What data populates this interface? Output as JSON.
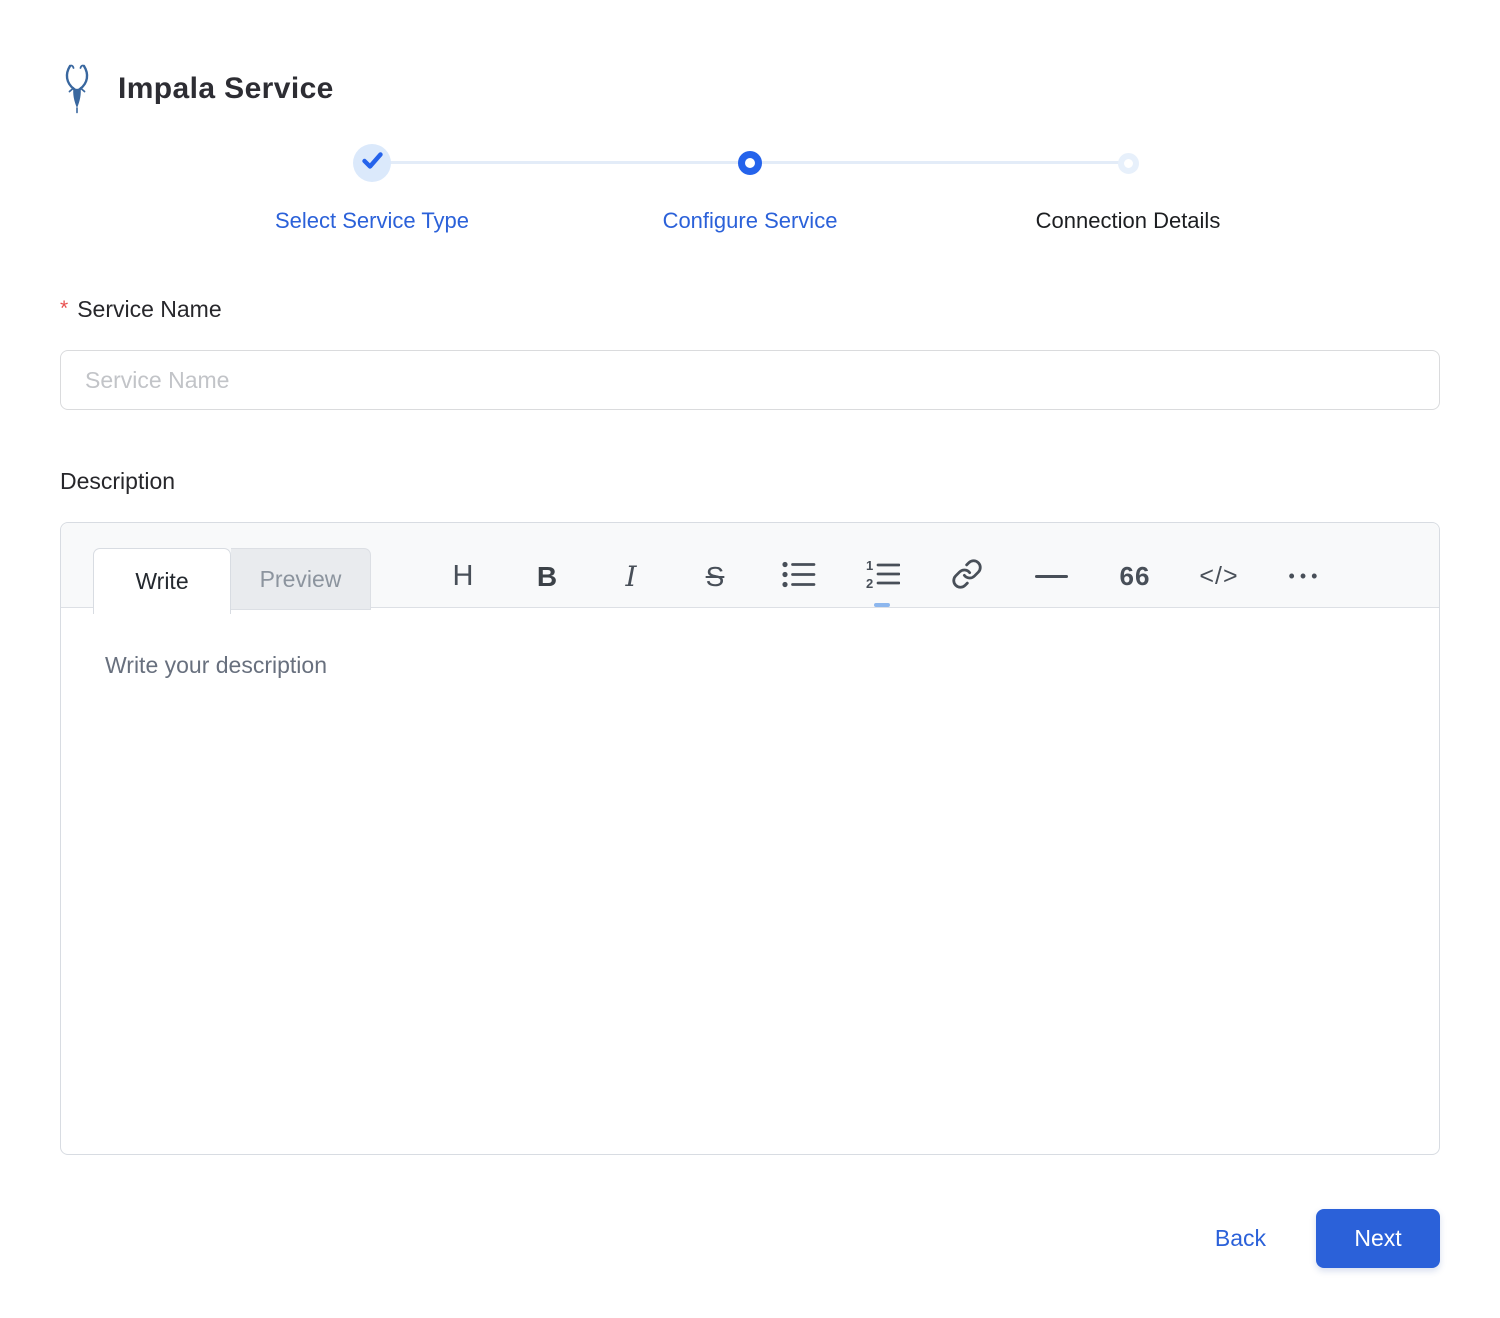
{
  "header": {
    "title": "Impala Service",
    "logo": "impala-antelope-logo"
  },
  "stepper": {
    "steps": [
      {
        "label": "Select Service Type",
        "state": "completed"
      },
      {
        "label": "Configure Service",
        "state": "active"
      },
      {
        "label": "Connection Details",
        "state": "pending"
      }
    ]
  },
  "form": {
    "service_name": {
      "label": "Service Name",
      "required_marker": "*",
      "value": "",
      "placeholder": "Service Name"
    },
    "description": {
      "label": "Description",
      "value": "",
      "placeholder": "Write your description"
    }
  },
  "editor": {
    "tabs": [
      {
        "label": "Write",
        "active": true
      },
      {
        "label": "Preview",
        "active": false
      }
    ],
    "toolbar": [
      {
        "name": "heading",
        "glyph": "H"
      },
      {
        "name": "bold",
        "glyph": "B"
      },
      {
        "name": "italic",
        "glyph": "I"
      },
      {
        "name": "strikethrough",
        "glyph": "S"
      },
      {
        "name": "unordered-list",
        "glyph": ""
      },
      {
        "name": "ordered-list",
        "glyph": ""
      },
      {
        "name": "link",
        "glyph": ""
      },
      {
        "name": "horizontal-rule",
        "glyph": ""
      },
      {
        "name": "quote",
        "glyph": "66"
      },
      {
        "name": "code",
        "glyph": "</>"
      },
      {
        "name": "more",
        "glyph": "•••"
      }
    ]
  },
  "footer": {
    "back_label": "Back",
    "next_label": "Next"
  },
  "colors": {
    "primary_blue": "#2b61d9",
    "step_accent_blue": "#2563eb",
    "step_halo_blue": "#dbe9fb",
    "step_pending_ring": "#e7f0fb",
    "connector": "#e3ecf8",
    "required_red": "#e8504f",
    "toolbar_icon": "#484f58",
    "editor_header_bg": "#f8f9fa",
    "border_gray": "#d8dce2",
    "placeholder_gray": "#c2c4c8",
    "textarea_placeholder": "#68707e"
  }
}
